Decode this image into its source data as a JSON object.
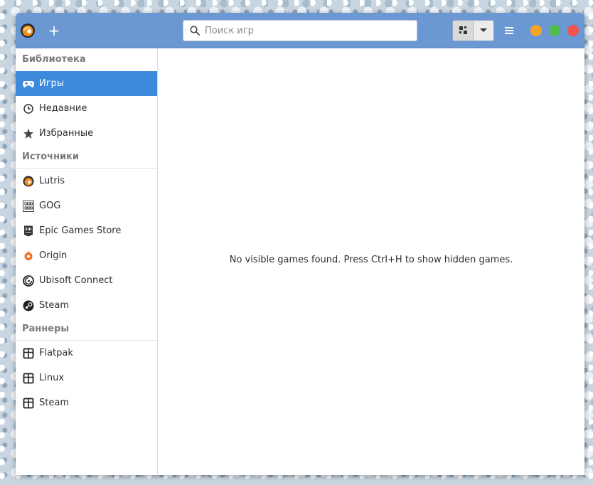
{
  "header": {
    "add_symbol": "+",
    "search_placeholder": "Поиск игр",
    "search_value": ""
  },
  "sidebar": {
    "sections": [
      {
        "title": "Библиотека"
      },
      {
        "title": "Источники"
      },
      {
        "title": "Раннеры"
      }
    ],
    "library": [
      {
        "label": "Игры",
        "icon": "gamepad-icon",
        "selected": true
      },
      {
        "label": "Недавние",
        "icon": "clock-icon"
      },
      {
        "label": "Избранные",
        "icon": "star-icon"
      }
    ],
    "sources": [
      {
        "label": "Lutris",
        "icon": "lutris-icon"
      },
      {
        "label": "GOG",
        "icon": "gog-icon"
      },
      {
        "label": "Epic Games Store",
        "icon": "epic-icon"
      },
      {
        "label": "Origin",
        "icon": "origin-icon"
      },
      {
        "label": "Ubisoft Connect",
        "icon": "ubisoft-icon"
      },
      {
        "label": "Steam",
        "icon": "steam-icon"
      }
    ],
    "runners": [
      {
        "label": "Flatpak",
        "icon": "package-icon"
      },
      {
        "label": "Linux",
        "icon": "package-icon"
      },
      {
        "label": "Steam",
        "icon": "package-icon"
      }
    ]
  },
  "content": {
    "empty_message": "No visible games found. Press Ctrl+H to show hidden games."
  },
  "colors": {
    "headerbar": "#6b97d3",
    "selection": "#3d8adc",
    "minimize": "#f5a623",
    "maximize": "#4dbd4b",
    "close": "#f0544c"
  }
}
